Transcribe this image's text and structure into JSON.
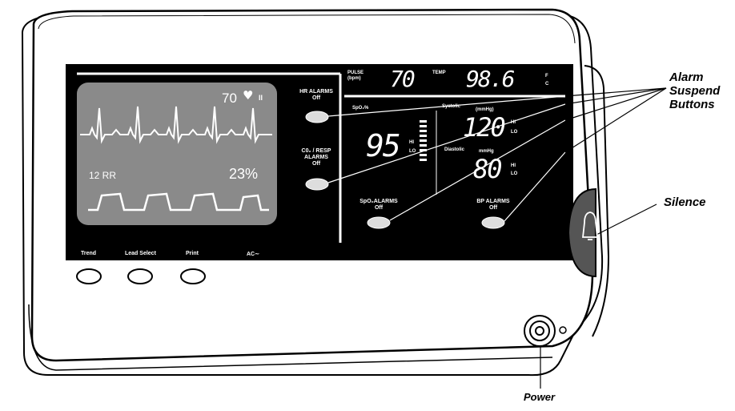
{
  "callouts": {
    "alarm_suspend_line1": "Alarm",
    "alarm_suspend_line2": "Suspend",
    "alarm_suspend_line3": "Buttons",
    "silence": "Silence",
    "power": "Power"
  },
  "waveform_panel": {
    "heart_rate": "70",
    "lead": "II",
    "resp_label": "12 RR",
    "percent": "23%"
  },
  "alarm_buttons": {
    "hr": {
      "line1": "HR ALARMS",
      "line2": "Off"
    },
    "co2": {
      "line1": "C0₂ / RESP",
      "line2": "ALARMS",
      "line3": "Off"
    },
    "spo2": {
      "line1": "SpO₂ALARMS",
      "line2": "Off"
    },
    "bp": {
      "line1": "BP ALARMS",
      "line2": "Off"
    }
  },
  "readouts": {
    "pulse_label": "PULSE",
    "pulse_unit": "(bpm)",
    "pulse_value": "70",
    "temp_label": "TEMP",
    "temp_value": "98.6",
    "temp_unit_f": "F",
    "temp_unit_c": "C",
    "spo2_label": "SpO₂%",
    "spo2_value": "95",
    "spo2_hi": "HI",
    "spo2_lo": "LO",
    "systolic_label": "Systolic",
    "systolic_unit": "(mmHg)",
    "systolic_value": "120",
    "diastolic_label": "Diastolic",
    "diastolic_unit": "mmHg",
    "diastolic_value": "80",
    "hi": "HI",
    "lo": "LO"
  },
  "bottom_buttons": {
    "trend": "Trend",
    "lead_select": "Lead Select",
    "print": "Print",
    "ac": "AC∼"
  }
}
